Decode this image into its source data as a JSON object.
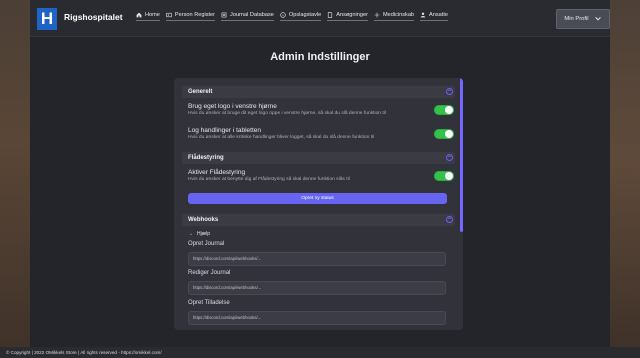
{
  "header": {
    "logo_text": "H",
    "brand": "Rigshospitalet",
    "nav": [
      {
        "label": "Home",
        "icon": "home-icon"
      },
      {
        "label": "Person Register",
        "icon": "person-register-icon"
      },
      {
        "label": "Journal Database",
        "icon": "journal-icon"
      },
      {
        "label": "Opslagstavle",
        "icon": "info-icon"
      },
      {
        "label": "Ansøgninger",
        "icon": "applications-icon"
      },
      {
        "label": "Medicinskab",
        "icon": "medicine-icon"
      },
      {
        "label": "Ansatte",
        "icon": "staff-icon"
      }
    ],
    "profile_label": "Min Profil"
  },
  "page": {
    "title": "Admin Indstillinger"
  },
  "sections": {
    "general": {
      "title": "Generelt",
      "items": [
        {
          "title": "Brug eget logo i venstre hjørne",
          "desc": "Hvis du ønsker at bruge dit eget logo oppe i venstre hjørne, så skal du slå denne funktion til",
          "enabled": true
        },
        {
          "title": "Log handlinger i tabletten",
          "desc": "Hvis du ønsker at alle kritiske handlinger bliver logget, så skal du slå denne funktion til",
          "enabled": true
        }
      ]
    },
    "fleet": {
      "title": "Flådestyring",
      "items": [
        {
          "title": "Aktiver Flådestyring",
          "desc": "Hvis du ønsker at benytte dig af Flådestyring så skal denne funktion slås til",
          "enabled": true
        }
      ],
      "button_label": "Opret ny status"
    },
    "webhooks": {
      "title": "Webhooks",
      "help_label": "Hjælp",
      "fields": [
        {
          "label": "Opret Journal",
          "value": "https://discord.com/api/webhooks/..."
        },
        {
          "label": "Rediger Journal",
          "value": "https://discord.com/api/webhooks/..."
        },
        {
          "label": "Opret Tilladelse",
          "value": "https://discord.com/api/webhooks/..."
        }
      ]
    }
  },
  "footer": {
    "text": "© Copyright | 2022 OMikkels Store | All rights reserved - https://omikkel.com/"
  },
  "colors": {
    "accent": "#6864f2",
    "toggle_on": "#35c24a"
  }
}
